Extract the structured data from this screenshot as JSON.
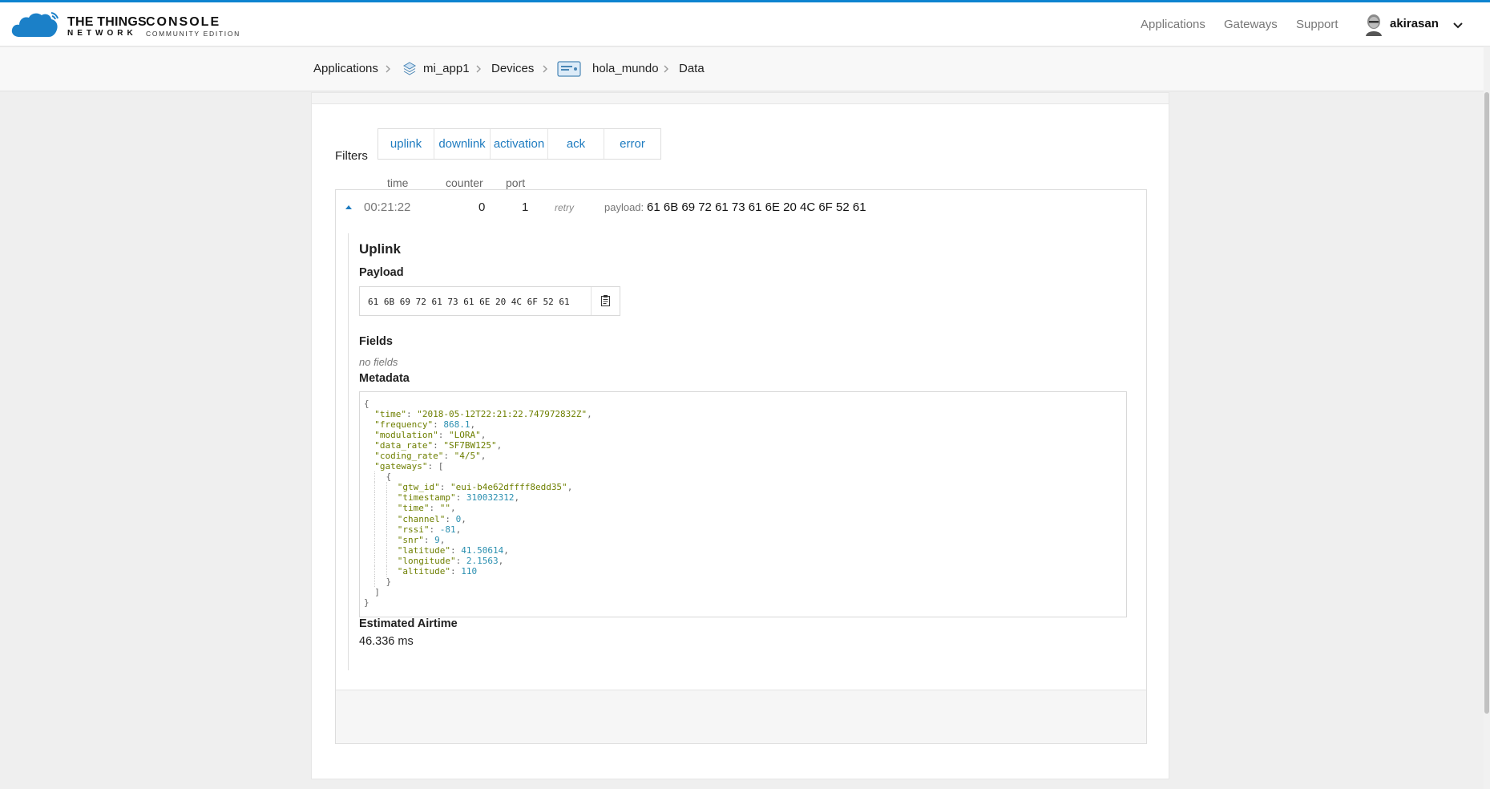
{
  "header": {
    "brand_line1": "THE THINGS",
    "brand_line2": "NETWORK",
    "console_line1": "CONSOLE",
    "console_line2": "COMMUNITY EDITION",
    "nav": [
      "Applications",
      "Gateways",
      "Support"
    ],
    "username": "akirasan",
    "accent_color": "#0d83d0"
  },
  "breadcrumb": {
    "items": [
      "Applications",
      "mi_app1",
      "Devices",
      "hola_mundo",
      "Data"
    ],
    "icons": [
      "layers-icon",
      "device-icon"
    ]
  },
  "filters": {
    "label": "Filters",
    "buttons": [
      "uplink",
      "downlink",
      "activation",
      "ack",
      "error"
    ]
  },
  "columns": {
    "time": "time",
    "counter": "counter",
    "port": "port"
  },
  "event": {
    "time": "00:21:22",
    "counter": "0",
    "port": "1",
    "tag": "retry",
    "payload_label": "payload:",
    "payload": "61 6B 69 72 61 73 61 6E 20 4C 6F 52 61"
  },
  "detail": {
    "title": "Uplink",
    "payload_heading": "Payload",
    "payload_value": "61 6B 69 72 61 73 61 6E 20 4C 6F 52 61",
    "fields_heading": "Fields",
    "fields_empty": "no fields",
    "metadata_heading": "Metadata",
    "metadata": {
      "time": "\"2018-05-12T22:21:22.747972832Z\"",
      "frequency": "868.1",
      "modulation": "\"LORA\"",
      "data_rate": "\"SF7BW125\"",
      "coding_rate": "\"4/5\"",
      "gtw_id": "\"eui-b4e62dffff8edd35\"",
      "timestamp": "310032312",
      "gw_time": "\"\"",
      "channel": "0",
      "rssi": "-81",
      "snr": "9",
      "latitude": "41.50614",
      "longitude": "2.1563",
      "altitude": "110"
    },
    "airtime_heading": "Estimated Airtime",
    "airtime_value": "46.336 ms"
  }
}
